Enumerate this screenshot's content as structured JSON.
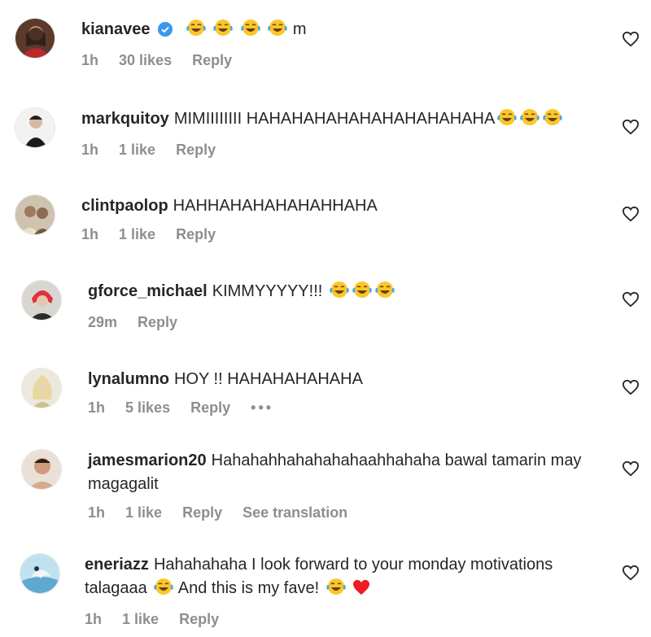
{
  "colors": {
    "text": "#262626",
    "meta": "#8e8e8e",
    "verified": "#3897f0",
    "red_heart": "#ed1c24"
  },
  "comments": [
    {
      "username": "kianavee",
      "verified": true,
      "text": "",
      "emoji_count": 4,
      "suffix": "m",
      "time": "1h",
      "likes": "30 likes",
      "reply": "Reply"
    },
    {
      "username": "markquitoy",
      "text": "MIMIIIIIIII HAHAHAHAHAHAHAHAHAHAHA",
      "emoji_count": 3,
      "time": "1h",
      "likes": "1 like",
      "reply": "Reply"
    },
    {
      "username": "clintpaolop",
      "text": "HAHHAHAHAHAHAHHAHA",
      "time": "1h",
      "likes": "1 like",
      "reply": "Reply"
    },
    {
      "username": "gforce_michael",
      "text": "KIMMYYYYY!!!",
      "emoji_count": 3,
      "time": "29m",
      "reply": "Reply"
    },
    {
      "username": "lynalumno",
      "text": "HOY !! HAHAHAHAHAHA",
      "time": "1h",
      "likes": "5 likes",
      "reply": "Reply",
      "more": "•••"
    },
    {
      "username": "jamesmarion20",
      "text": "Hahahahhahahahahaahhahaha bawal tamarin may magagalit",
      "time": "1h",
      "likes": "1 like",
      "reply": "Reply",
      "translation": "See translation"
    },
    {
      "username": "eneriazz",
      "text_part1": "Hahahahaha I look forward to your monday motivations talagaaa",
      "text_part2": "And this is my fave!",
      "time": "1h",
      "likes": "1 like",
      "reply": "Reply"
    }
  ],
  "icons": {
    "heart": "heart-outline-icon",
    "verified": "verified-badge-icon",
    "emoji": "face-with-tears-of-joy-emoji",
    "more": "more-options-icon"
  }
}
